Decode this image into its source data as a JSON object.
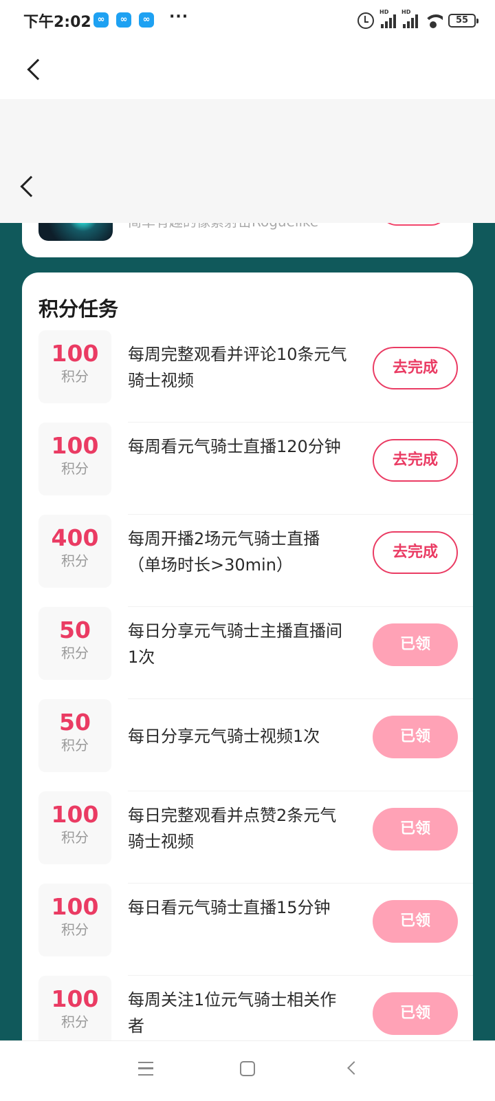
{
  "status_bar": {
    "time": "下午2:02",
    "app_icon_glyph": "∞",
    "more": "···",
    "hd_label": "HD",
    "battery": "55"
  },
  "icons": {
    "back": "chevron-left-icon",
    "alarm": "alarm-icon",
    "signal": "signal-icon",
    "wifi": "wifi-icon",
    "battery": "battery-icon",
    "menu": "menu-icon",
    "home": "home-icon",
    "nav_back": "back-icon"
  },
  "partial_game": {
    "description": "简单有趣的像素射击Roguelike"
  },
  "task_section": {
    "title": "积分任务",
    "unit": "积分",
    "tasks": [
      {
        "points": "100",
        "text": "每周完整观看并评论10条元气骑士视频",
        "button": "去完成",
        "status": "todo"
      },
      {
        "points": "100",
        "text": "每周看元气骑士直播120分钟",
        "button": "去完成",
        "status": "todo"
      },
      {
        "points": "400",
        "text": "每周开播2场元气骑士直播（单场时长>30min）",
        "button": "去完成",
        "status": "todo"
      },
      {
        "points": "50",
        "text": "每日分享元气骑士主播直播间1次",
        "button": "已领",
        "status": "done"
      },
      {
        "points": "50",
        "text": "每日分享元气骑士视频1次",
        "button": "已领",
        "status": "done"
      },
      {
        "points": "100",
        "text": "每日完整观看并点赞2条元气骑士视频",
        "button": "已领",
        "status": "done"
      },
      {
        "points": "100",
        "text": "每日看元气骑士直播15分钟",
        "button": "已领",
        "status": "done"
      },
      {
        "points": "100",
        "text": "每周关注1位元气骑士相关作者",
        "button": "已领",
        "status": "done"
      }
    ]
  },
  "colors": {
    "teal_background": "#10595b",
    "accent_pink": "#ea3b63",
    "claimed_pink": "#ffa2b6"
  }
}
